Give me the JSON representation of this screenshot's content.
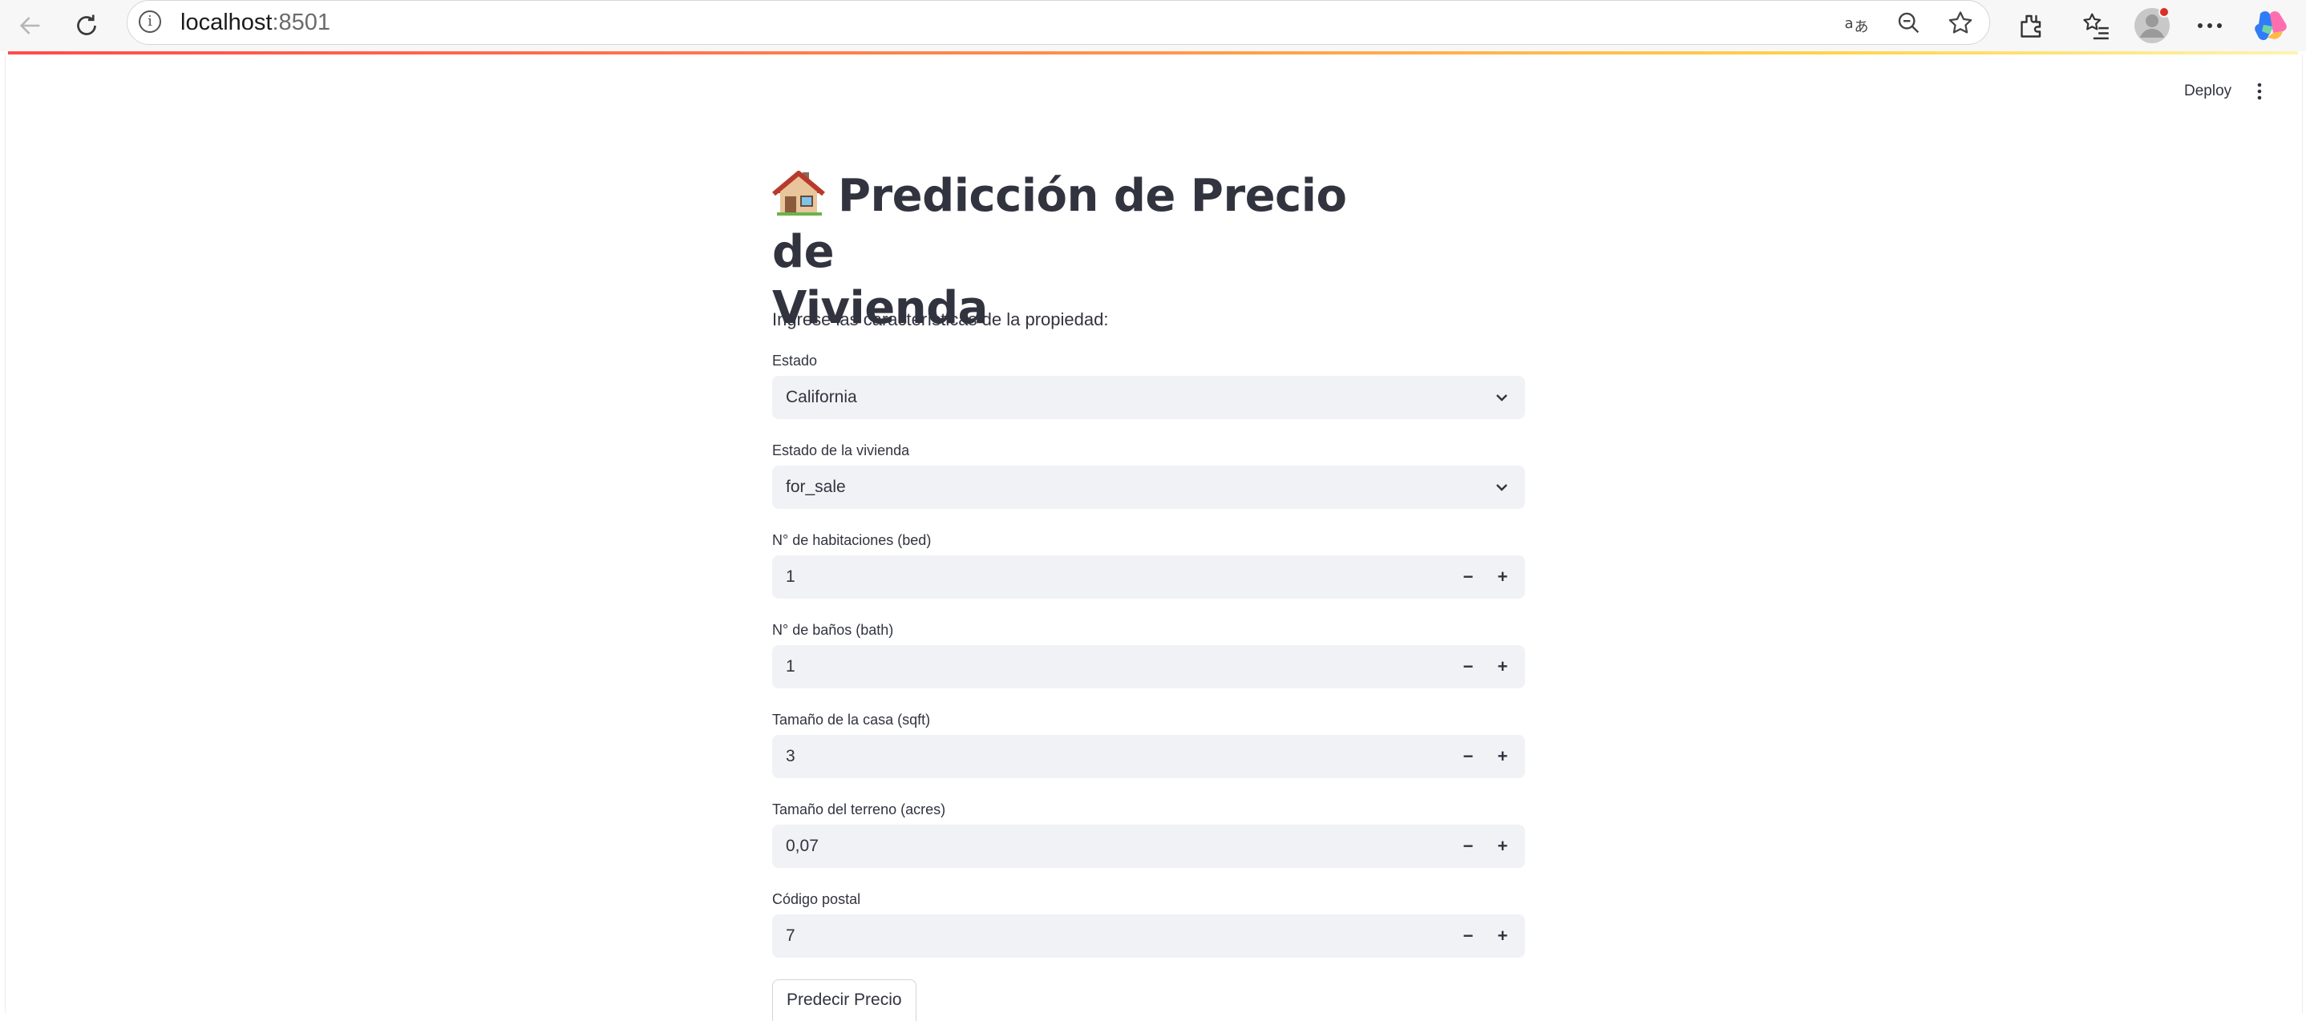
{
  "browser": {
    "url_host": "localhost",
    "url_port": ":8501"
  },
  "app": {
    "deploy_label": "Deploy",
    "title_emoji": "🏠",
    "title_line1": "Predicción de Precio de",
    "title_line2": "Vivienda",
    "subtitle": "Ingrese las características de la propiedad:"
  },
  "form": {
    "estado": {
      "label": "Estado",
      "value": "California"
    },
    "estado_vivienda": {
      "label": "Estado de la vivienda",
      "value": "for_sale"
    },
    "bed": {
      "label": "N° de habitaciones (bed)",
      "value": "1"
    },
    "bath": {
      "label": "N° de baños (bath)",
      "value": "1"
    },
    "house_size": {
      "label": "Tamaño de la casa (sqft)",
      "value": "3"
    },
    "acre_lot": {
      "label": "Tamaño del terreno (acres)",
      "value": "0,07"
    },
    "zip_code": {
      "label": "Código postal",
      "value": "7"
    },
    "submit_label": "Predecir Precio"
  },
  "stepper": {
    "minus": "−",
    "plus": "+"
  },
  "colors": {
    "accent": "#ff4b4b",
    "input_bg": "#f0f2f6",
    "text": "#31333f"
  }
}
